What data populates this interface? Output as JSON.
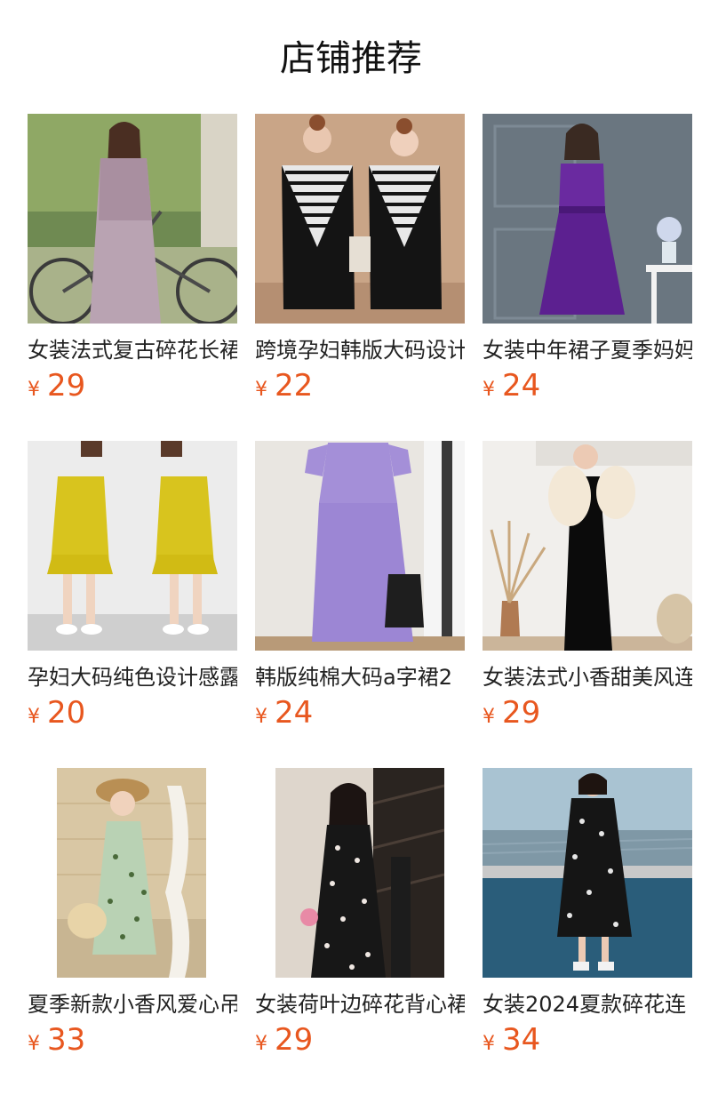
{
  "section": {
    "title": "店铺推荐"
  },
  "colors": {
    "price": "#e8571f",
    "text": "#222222"
  },
  "products": [
    {
      "name": "女装法式复古碎花长裙",
      "currency": "¥",
      "price": "29",
      "image": "floral-dress-bicycle"
    },
    {
      "name": "跨境孕妇韩版大码设计",
      "currency": "¥",
      "price": "22",
      "image": "striped-v-black-dress"
    },
    {
      "name": "女装中年裙子夏季妈妈",
      "currency": "¥",
      "price": "24",
      "image": "purple-belted-dress"
    },
    {
      "name": "孕妇大码纯色设计感露",
      "currency": "¥",
      "price": "20",
      "image": "yellow-cold-shoulder-dress"
    },
    {
      "name": "韩版纯棉大码a字裙2",
      "currency": "¥",
      "price": "24",
      "image": "lavender-linen-dress"
    },
    {
      "name": "女装法式小香甜美风连",
      "currency": "¥",
      "price": "29",
      "image": "black-dress-cream-sleeves"
    },
    {
      "name": "夏季新款小香风爱心吊",
      "currency": "¥",
      "price": "33",
      "image": "mint-print-sundress"
    },
    {
      "name": "女装荷叶边碎花背心裙",
      "currency": "¥",
      "price": "29",
      "image": "black-floral-ruffle-dress"
    },
    {
      "name": "女装2024夏款碎花连",
      "currency": "¥",
      "price": "34",
      "image": "black-floral-seaside-dress"
    }
  ]
}
